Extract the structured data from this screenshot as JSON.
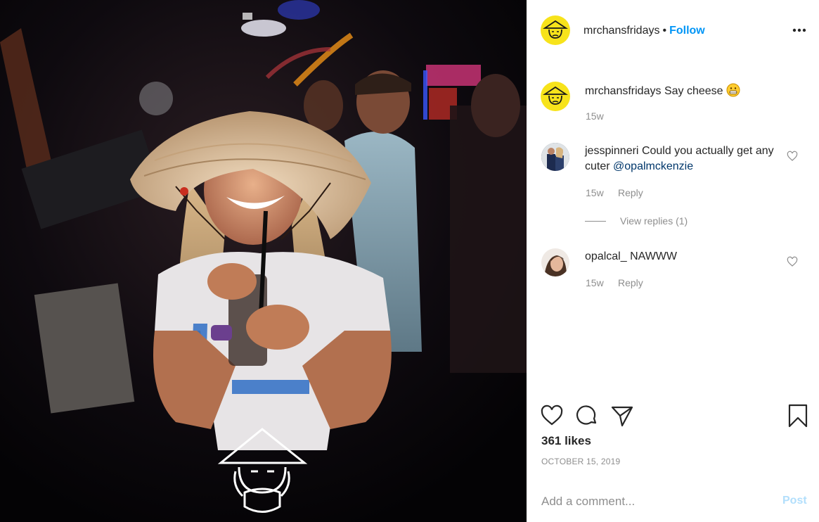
{
  "post": {
    "username": "mrchansfridays",
    "separator": "•",
    "follow_label": "Follow",
    "more_icon": "more-options-icon"
  },
  "caption": {
    "username": "mrchansfridays",
    "text": "Say cheese",
    "emoji": "grinning-face-emoji",
    "time": "15w"
  },
  "comments": [
    {
      "username": "jesspinneri",
      "text": "Could you actually get any cuter",
      "mention": "@opalmckenzie",
      "time": "15w",
      "reply_label": "Reply",
      "view_replies": "View replies (1)"
    },
    {
      "username": "opalcal_",
      "text": "NAWWW",
      "time": "15w",
      "reply_label": "Reply"
    }
  ],
  "actions": {
    "like_icon": "heart-icon",
    "comment_icon": "comment-bubble-icon",
    "share_icon": "paper-plane-icon",
    "save_icon": "bookmark-icon"
  },
  "likes": "361 likes",
  "date": "OCTOBER 15, 2019",
  "comment_box": {
    "placeholder": "Add a comment...",
    "post_label": "Post"
  },
  "colors": {
    "accent": "#0095f6",
    "avatar_bg": "#f7e31b",
    "post_disabled": "#b2dffc",
    "muted": "#8e8e8e"
  }
}
